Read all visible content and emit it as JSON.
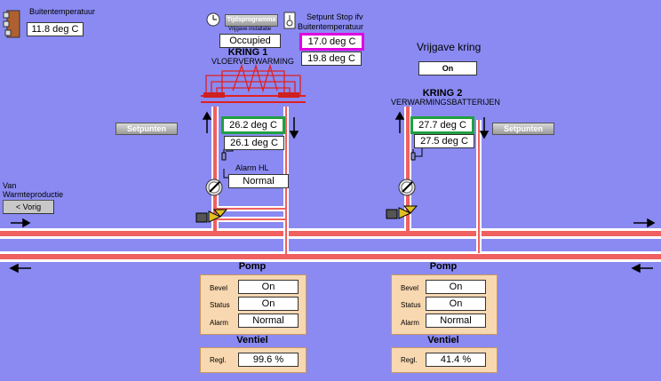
{
  "outside": {
    "label": "Buitentemperatuur",
    "value": "11.8 deg C"
  },
  "schedule": {
    "button": "Tijdsprogramma",
    "sub": "Vrijgave installatie",
    "value": "Occupied"
  },
  "setpoint_stop": {
    "label1": "Setpunt Stop ifv",
    "label2": "Buitentemperatuur",
    "value1": "17.0 deg C",
    "value2": "19.8 deg C"
  },
  "release": {
    "label": "Vrijgave kring",
    "value": "On"
  },
  "circuit1": {
    "title": "KRING 1",
    "subtitle": "VLOERVERWARMING",
    "supply": "26.2 deg C",
    "return": "26.1 deg C",
    "setpoints_button": "Setpunten",
    "alarm_label": "Alarm HL",
    "alarm_value": "Normal",
    "pump": {
      "title": "Pomp",
      "bevel_label": "Bevel",
      "bevel": "On",
      "status_label": "Status",
      "status": "On",
      "alarm_label": "Alarm",
      "alarm": "Normal"
    },
    "valve": {
      "title": "Ventiel",
      "regl_label": "Regl.",
      "regl": "99.6 %"
    }
  },
  "circuit2": {
    "title": "KRING 2",
    "subtitle": "VERWARMINGSBATTERIJEN",
    "supply": "27.7 deg C",
    "return": "27.5 deg C",
    "setpoints_button": "Setpunten",
    "pump": {
      "title": "Pomp",
      "bevel_label": "Bevel",
      "bevel": "On",
      "status_label": "Status",
      "status": "On",
      "alarm_label": "Alarm",
      "alarm": "Normal"
    },
    "valve": {
      "title": "Ventiel",
      "regl_label": "Regl.",
      "regl": "41.4 %"
    }
  },
  "nav": {
    "from_label1": "Van",
    "from_label2": "Warmteproductie",
    "prev_button": "< Vorig"
  },
  "colors": {
    "background": "#8a8af2",
    "pipe_hot": "#f06060",
    "pipe_cold": "#ffffff",
    "highlight": "#e000e0",
    "active_frame": "#20a040"
  }
}
